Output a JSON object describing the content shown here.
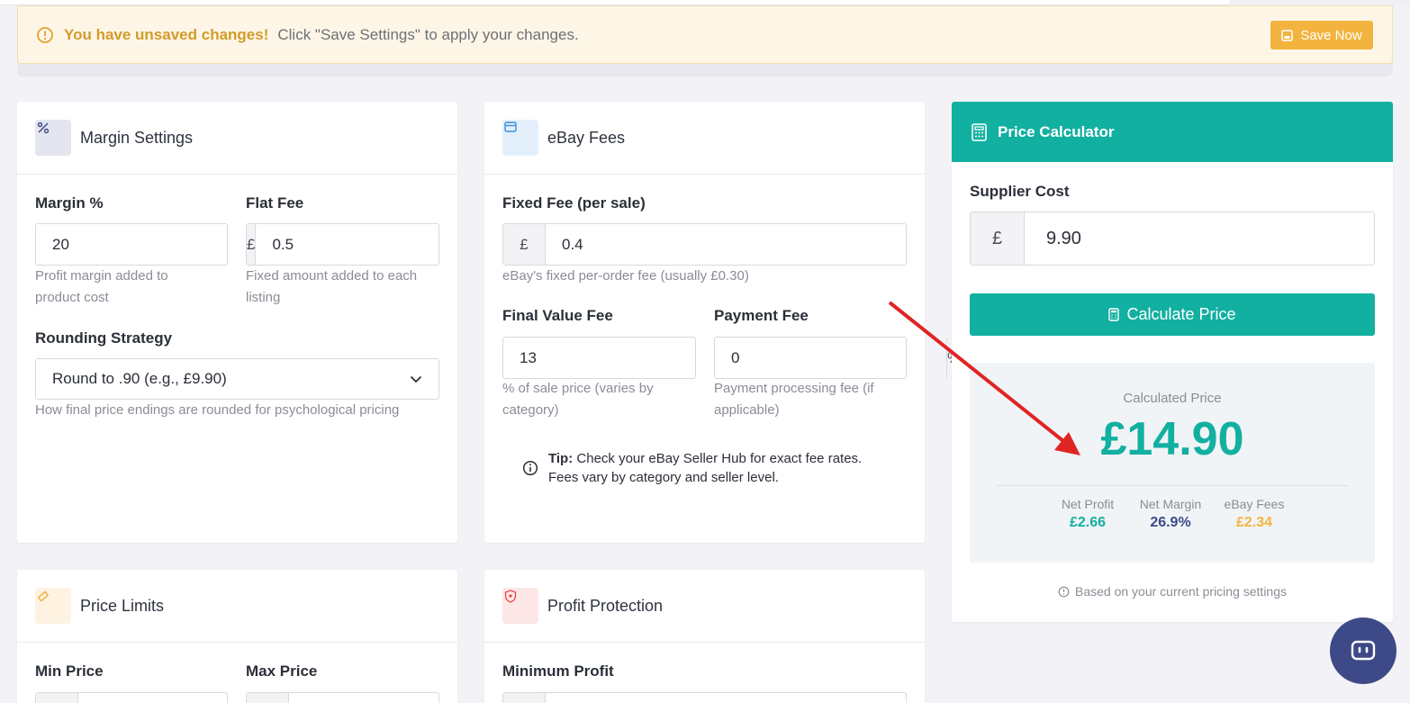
{
  "alert": {
    "strong": "You have unsaved changes!",
    "message": "Click \"Save Settings\" to apply your changes.",
    "save_button": "Save Now"
  },
  "margin": {
    "title": "Margin Settings",
    "margin_label": "Margin %",
    "margin_value": "20",
    "margin_suffix": "%",
    "margin_help": "Profit margin added to product cost",
    "flat_label": "Flat Fee",
    "flat_prefix": "£",
    "flat_value": "0.5",
    "flat_help": "Fixed amount added to each listing",
    "rounding_label": "Rounding Strategy",
    "rounding_value": "Round to .90 (e.g., £9.90)",
    "rounding_help": "How final price endings are rounded for psychological pricing"
  },
  "fees": {
    "title": "eBay Fees",
    "fixed_label": "Fixed Fee (per sale)",
    "fixed_prefix": "£",
    "fixed_value": "0.4",
    "fixed_help": "eBay's fixed per-order fee (usually £0.30)",
    "fvf_label": "Final Value Fee",
    "fvf_value": "13",
    "fvf_suffix": "%",
    "fvf_help": "% of sale price (varies by category)",
    "pay_label": "Payment Fee",
    "pay_value": "0",
    "pay_suffix": "%",
    "pay_help": "Payment processing fee (if applicable)",
    "tip_strong": "Tip:",
    "tip_text": "Check your eBay Seller Hub for exact fee rates. Fees vary by category and seller level."
  },
  "limits": {
    "title": "Price Limits",
    "min_label": "Min Price",
    "max_label": "Max Price"
  },
  "protection": {
    "title": "Profit Protection",
    "min_profit_label": "Minimum Profit"
  },
  "calculator": {
    "title": "Price Calculator",
    "cost_label": "Supplier Cost",
    "cost_prefix": "£",
    "cost_value": "9.90",
    "button": "Calculate Price",
    "result_label": "Calculated Price",
    "result_value": "£14.90",
    "net_profit_label": "Net Profit",
    "net_profit_value": "£2.66",
    "net_margin_label": "Net Margin",
    "net_margin_value": "26.9%",
    "ebay_fees_label": "eBay Fees",
    "ebay_fees_value": "£2.34",
    "footnote": "Based on your current pricing settings"
  },
  "colors": {
    "accent": "#12b0a0",
    "warning": "#f3b43f",
    "annotation_arrow": "#e02424",
    "chat": "#3e4a87"
  }
}
